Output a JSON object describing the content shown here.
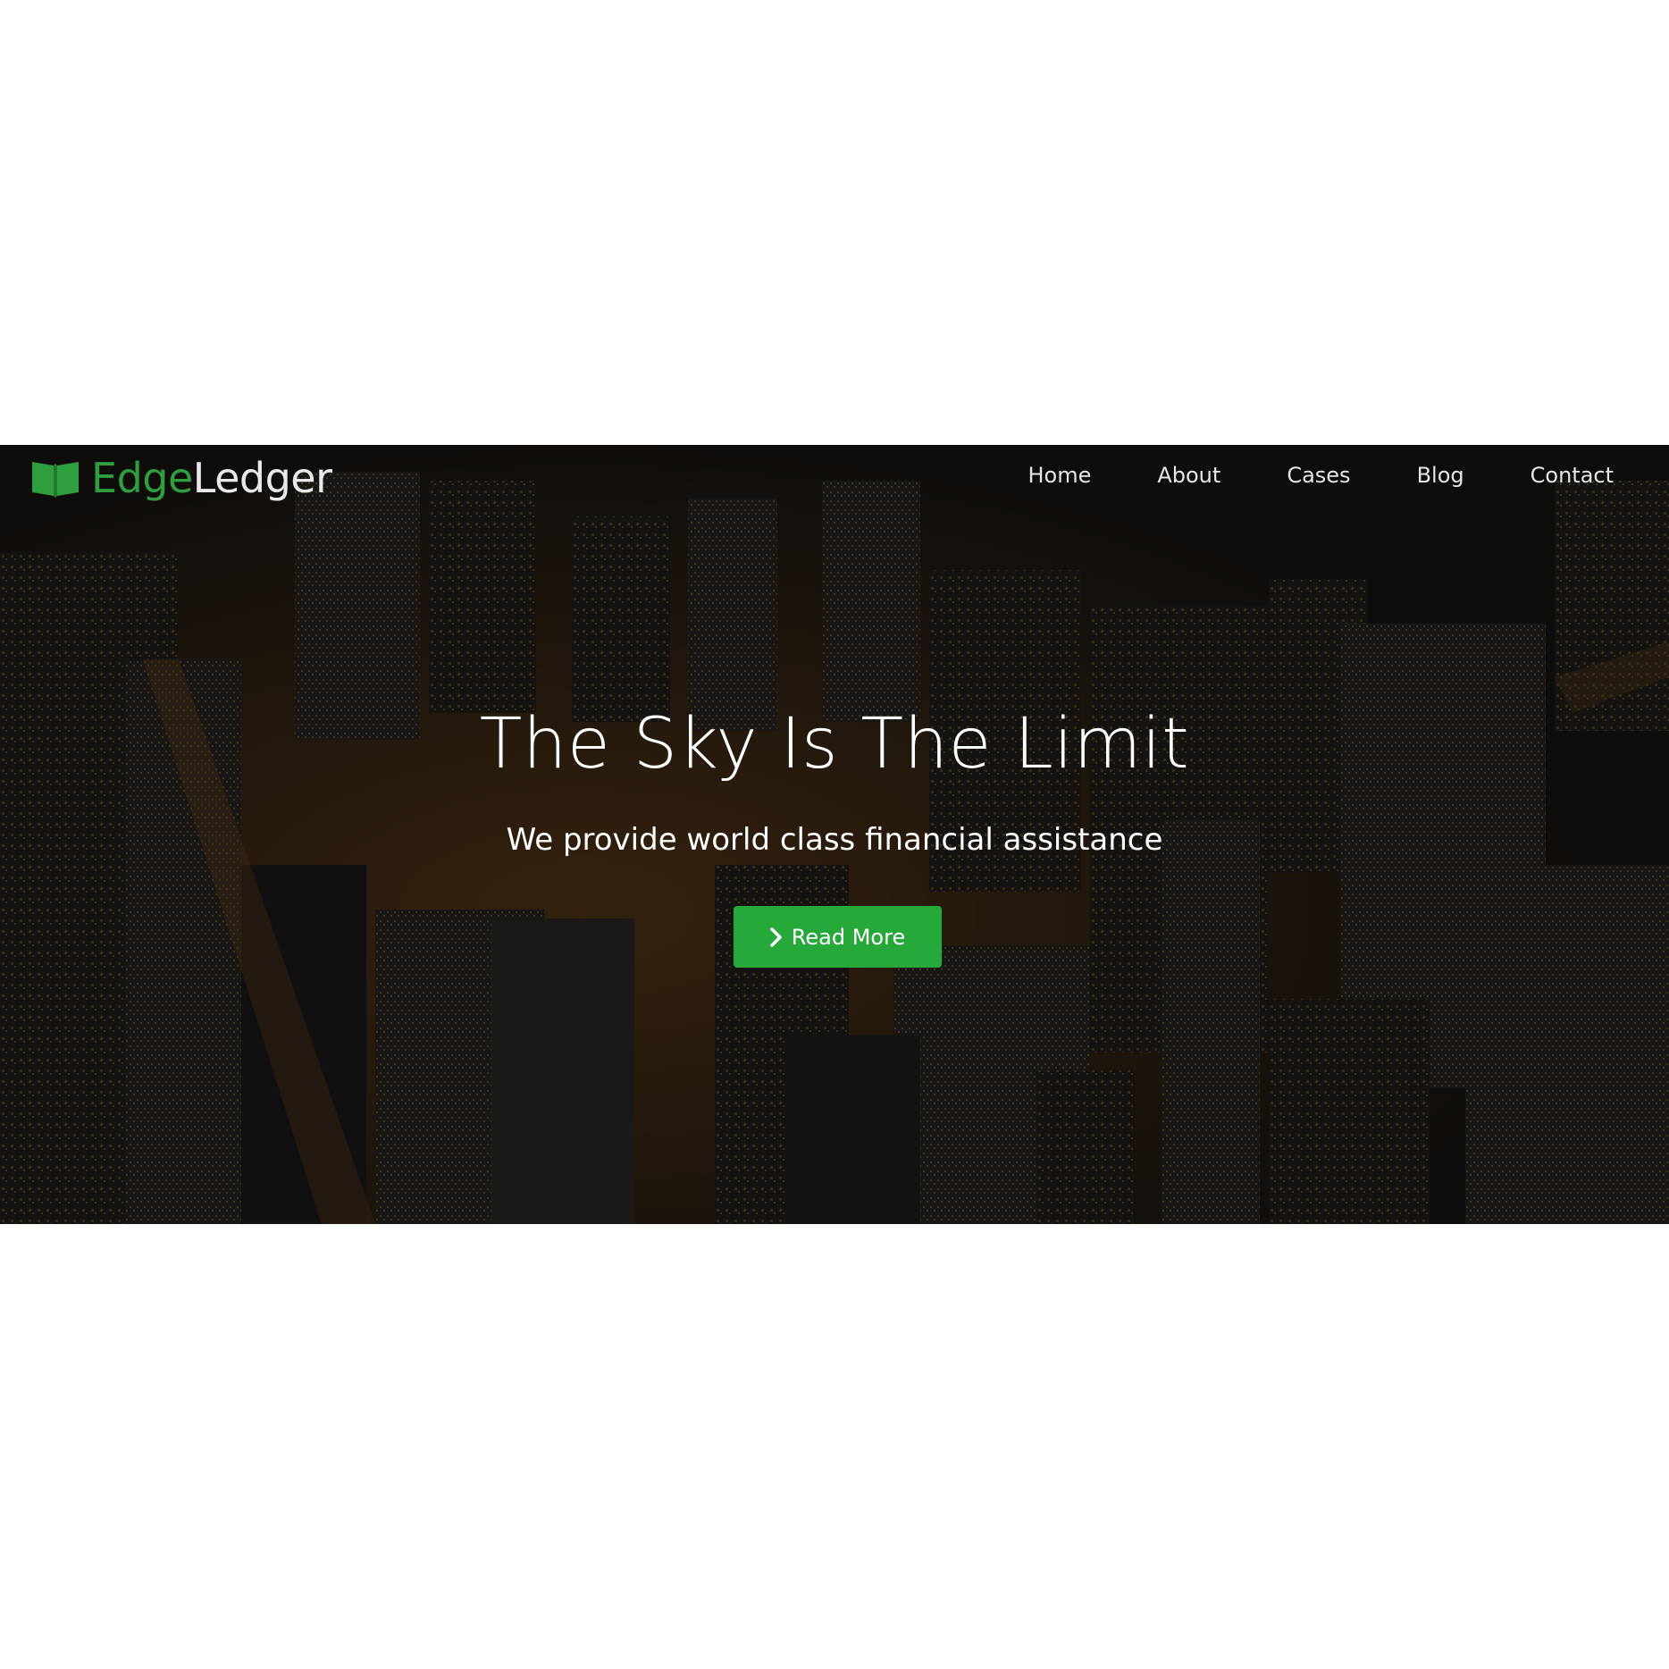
{
  "brand": {
    "name_part1": "Edge",
    "name_part2": "Ledger",
    "icon": "open-book-icon",
    "accent_color": "#2f9e3f"
  },
  "nav": {
    "items": [
      {
        "label": "Home"
      },
      {
        "label": "About"
      },
      {
        "label": "Cases"
      },
      {
        "label": "Blog"
      },
      {
        "label": "Contact"
      }
    ]
  },
  "hero": {
    "title": "The Sky Is The Limit",
    "subtitle": "We provide world class financial assistance",
    "background": "night-city-aerial-image",
    "cta": {
      "label": "Read More",
      "icon": "chevron-right-icon",
      "color": "#27a83a"
    }
  }
}
